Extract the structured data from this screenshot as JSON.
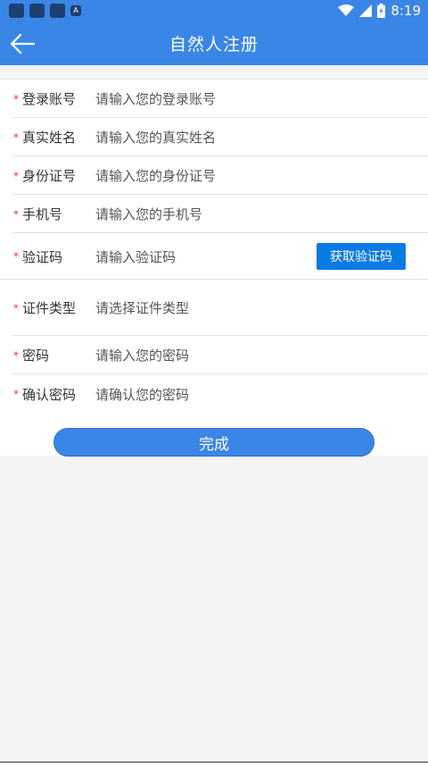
{
  "status_bar": {
    "time": "8:19",
    "notif_glyph": "A"
  },
  "header": {
    "title": "自然人注册"
  },
  "form": {
    "required_mark": "*",
    "rows": [
      {
        "label": "登录账号",
        "placeholder": "请输入您的登录账号"
      },
      {
        "label": "真实姓名",
        "placeholder": "请输入您的真实姓名"
      },
      {
        "label": "身份证号",
        "placeholder": "请输入您的身份证号"
      },
      {
        "label": "手机号",
        "placeholder": "请输入您的手机号"
      },
      {
        "label": "验证码",
        "placeholder": "请输入验证码"
      },
      {
        "label": "证件类型",
        "placeholder": "请选择证件类型"
      },
      {
        "label": "密码",
        "placeholder": "请输入您的密码"
      },
      {
        "label": "确认密码",
        "placeholder": "请确认您的密码"
      }
    ],
    "get_code_label": "获取验证码"
  },
  "submit_label": "完成",
  "colors": {
    "primary": "#3a86e6",
    "button": "#0c7ae4",
    "required": "#e23b2f"
  },
  "icons": {
    "back": "arrow-left-icon",
    "wifi": "wifi-icon",
    "signal": "signal-icon",
    "battery": "battery-icon"
  }
}
